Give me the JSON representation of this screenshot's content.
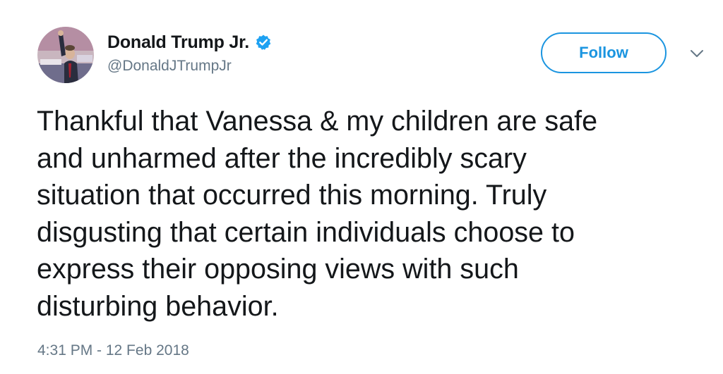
{
  "user": {
    "display_name": "Donald Trump Jr.",
    "handle": "@DonaldJTrumpJr",
    "verified": true,
    "verified_icon": "verified-badge-icon",
    "verified_color": "#1da1f2"
  },
  "actions": {
    "follow_label": "Follow",
    "follow_color": "#1b95e0",
    "more_icon": "chevron-down-icon"
  },
  "tweet": {
    "lines": [
      "Thankful that Vanessa & my children are safe",
      "and unharmed after the incredibly scary",
      "situation that occurred this morning. Truly",
      "disgusting that certain individuals choose to",
      "express their opposing views with such",
      "disturbing behavior."
    ],
    "timestamp": "4:31 PM - 12 Feb 2018"
  },
  "colors": {
    "text_primary": "#14171a",
    "text_secondary": "#657786",
    "background": "#ffffff"
  }
}
